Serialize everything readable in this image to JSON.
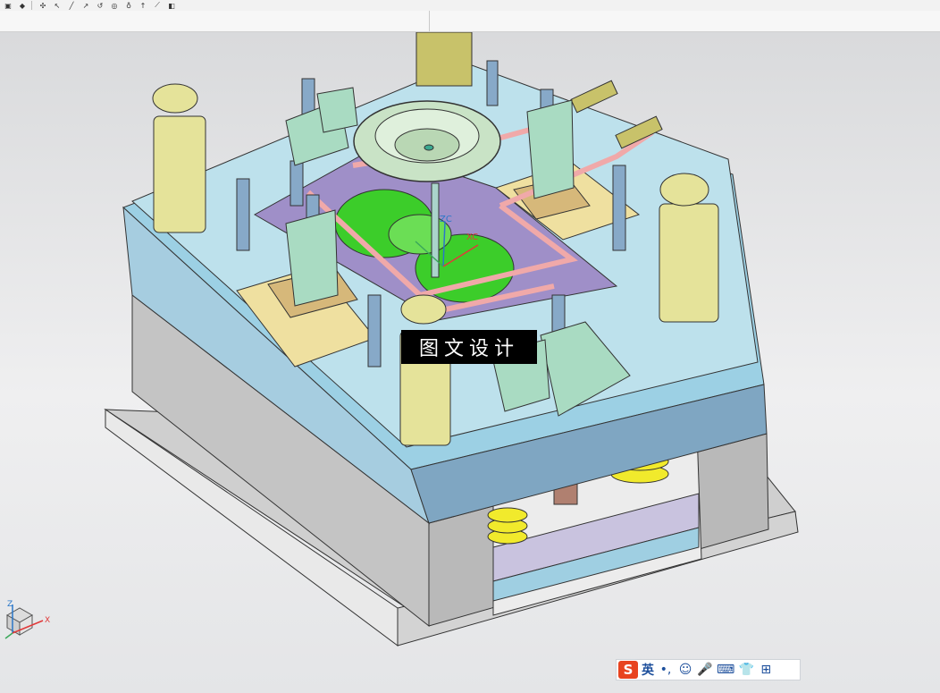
{
  "toolbar": {
    "icons": [
      "cube-view-icon",
      "shaded-view-icon",
      "snap-icon",
      "select-icon",
      "line-tool-icon",
      "arc-tool-icon",
      "rotate-icon",
      "measure-icon",
      "point-icon",
      "arrow-icon",
      "section-icon",
      "layer-icon"
    ]
  },
  "viewport": {
    "watermark": "图文设计",
    "datum_labels": {
      "zc": "ZC",
      "xc": "XC"
    },
    "triad_labels": {
      "z": "Z",
      "x": "X"
    }
  },
  "ime_bar": {
    "logo": "S",
    "lang": "英",
    "items": [
      "•,",
      "☺",
      "🎤",
      "⌨",
      "👕",
      "⊞"
    ]
  },
  "colors": {
    "clamp_plate": "#9cd0e4",
    "ejector_base": "#cfcfcf",
    "guide_pillar": "#e5e39a",
    "cavity_plate": "#9f8fc8",
    "core_insert": "#3ccd2a",
    "cooling_line": "#f0a9a9",
    "locating_ring": "#c9e3c6",
    "spring": "#f1ea2c"
  }
}
